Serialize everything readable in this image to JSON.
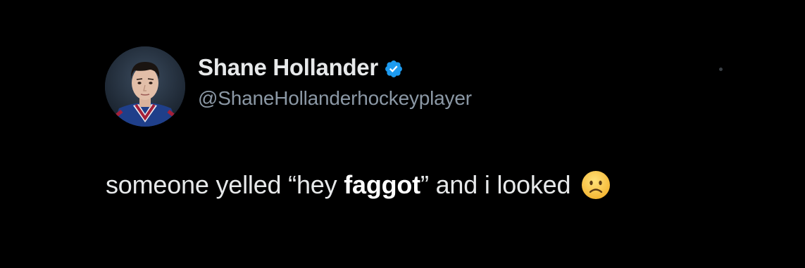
{
  "user": {
    "display_name": "Shane Hollander",
    "handle": "@ShaneHollanderhockeyplayer",
    "verified": true,
    "verified_icon": "verified-badge-icon",
    "verified_color": "#1d9bf0",
    "avatar": "profile-photo"
  },
  "tweet": {
    "text_before": "someone yelled “hey ",
    "text_bold": "faggot",
    "text_after": "” and i looked",
    "emoji": "frowning-face-emoji"
  },
  "theme": {
    "background": "#000000",
    "text_primary": "#e7e9ea",
    "text_secondary": "#8b98a5"
  }
}
